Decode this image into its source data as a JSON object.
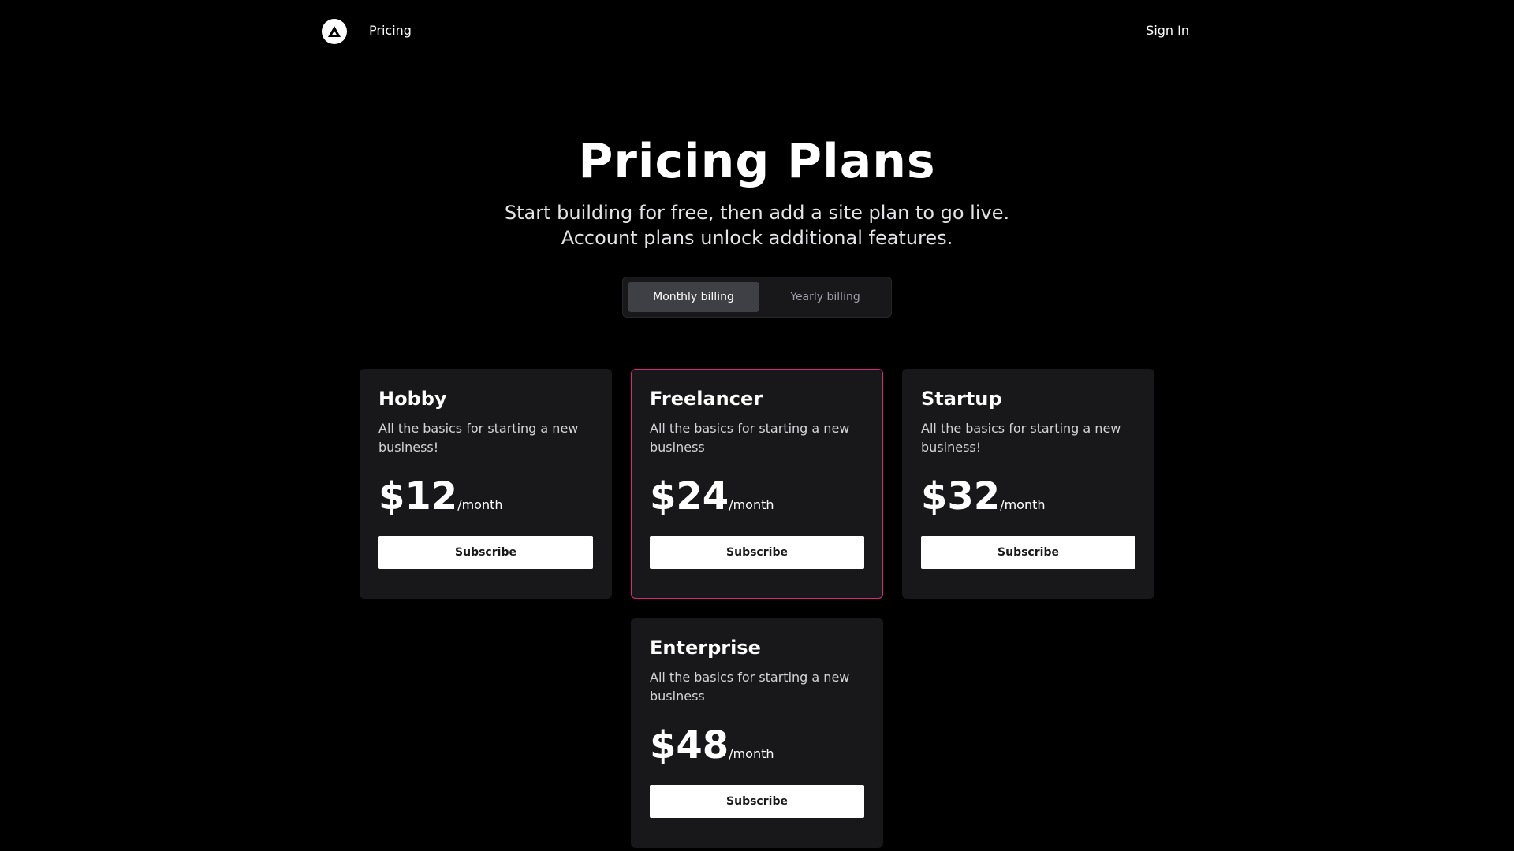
{
  "nav": {
    "links": [
      "Pricing"
    ],
    "signin_label": "Sign In"
  },
  "hero": {
    "title": "Pricing Plans",
    "subtitle": "Start building for free, then add a site plan to go live. Account plans unlock additional features."
  },
  "billing_toggle": {
    "options": [
      "Monthly billing",
      "Yearly billing"
    ],
    "selected": "Monthly billing"
  },
  "plans": [
    {
      "name": "Hobby",
      "description": "All the basics for starting a new business!",
      "price": "$12",
      "period": "/month",
      "button": "Subscribe",
      "featured": false
    },
    {
      "name": "Freelancer",
      "description": "All the basics for starting a new business",
      "price": "$24",
      "period": "/month",
      "button": "Subscribe",
      "featured": true
    },
    {
      "name": "Startup",
      "description": "All the basics for starting a new business!",
      "price": "$32",
      "period": "/month",
      "button": "Subscribe",
      "featured": false
    },
    {
      "name": "Enterprise",
      "description": "All the basics for starting a new business",
      "price": "$48",
      "period": "/month",
      "button": "Subscribe",
      "featured": false
    }
  ],
  "colors": {
    "background": "#000000",
    "card": "#18181b",
    "featured_border": "#db2777",
    "button": "#ffffff"
  }
}
